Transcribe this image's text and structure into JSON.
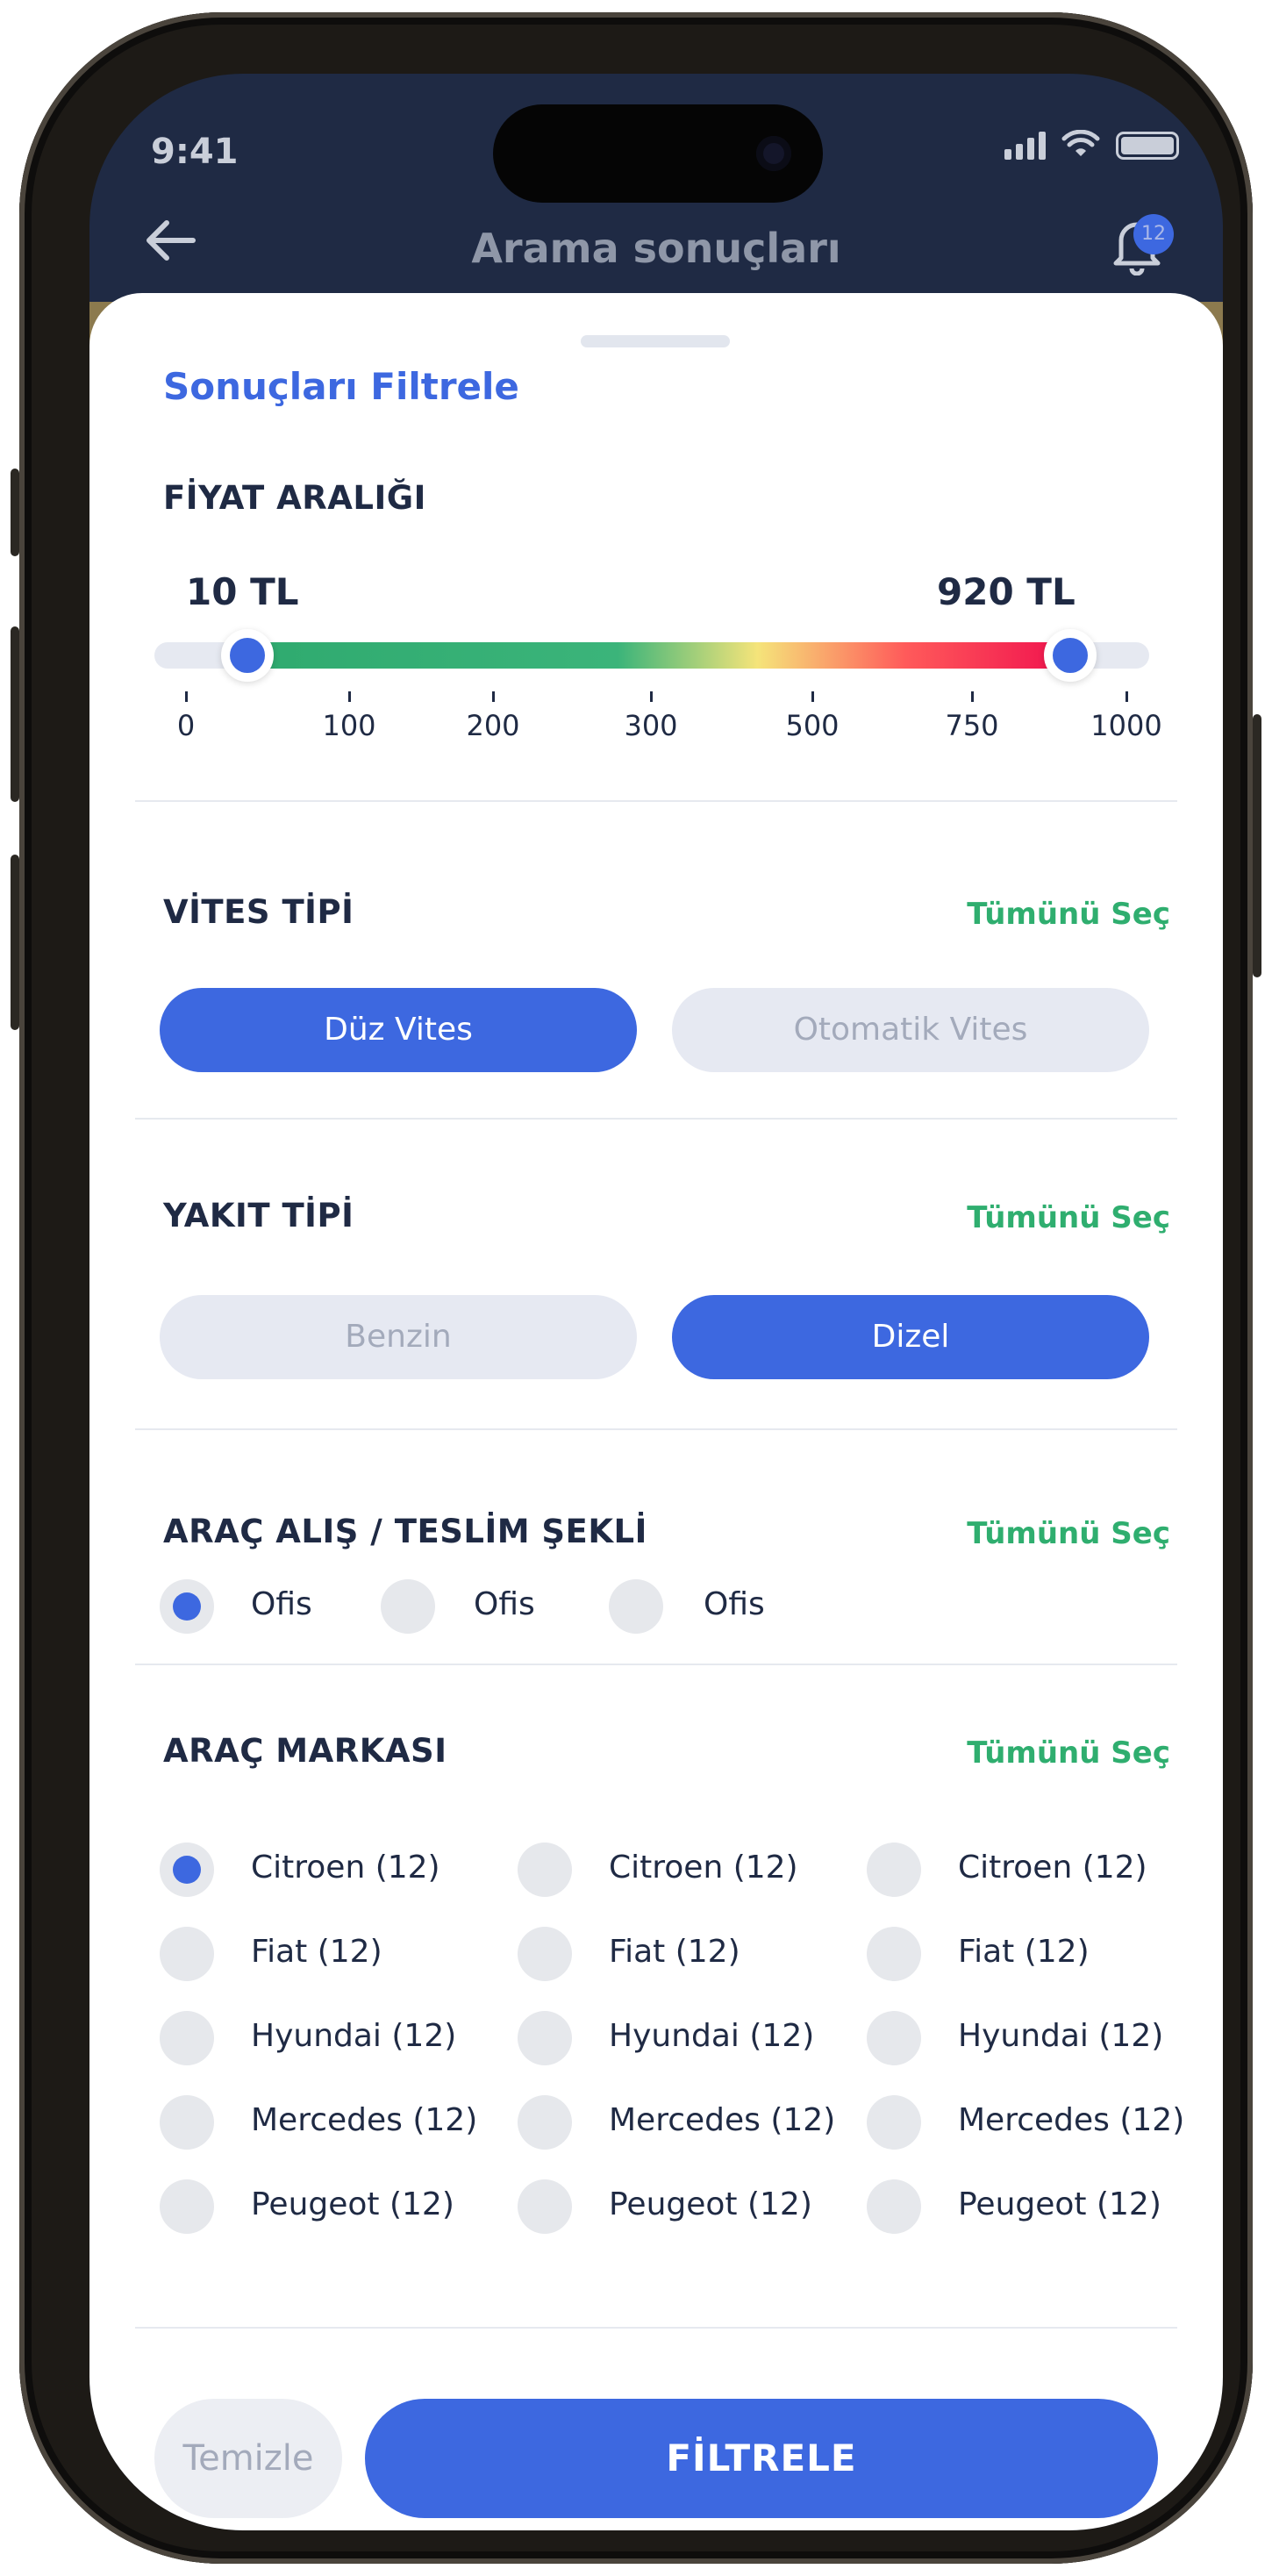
{
  "status_bar": {
    "time": "9:41"
  },
  "header": {
    "title": "Arama sonuçları",
    "notification_count": "12"
  },
  "sheet": {
    "title": "Sonuçları Filtrele",
    "price": {
      "title": "FİYAT ARALIĞI",
      "min_label": "10 TL",
      "max_label": "920 TL",
      "min_value": 10,
      "max_value": 920,
      "ticks": [
        "0",
        "100",
        "200",
        "300",
        "500",
        "750",
        "1000"
      ]
    },
    "gear": {
      "title": "VİTES TİPİ",
      "select_all": "Tümünü Seç",
      "options": [
        {
          "label": "Düz Vites",
          "selected": true
        },
        {
          "label": "Otomatik Vites",
          "selected": false
        }
      ]
    },
    "fuel": {
      "title": "YAKIT TİPİ",
      "select_all": "Tümünü Seç",
      "options": [
        {
          "label": "Benzin",
          "selected": false
        },
        {
          "label": "Dizel",
          "selected": true
        }
      ]
    },
    "pickup": {
      "title": "ARAÇ ALIŞ / TESLİM ŞEKLİ",
      "select_all": "Tümünü Seç",
      "options": [
        {
          "label": "Ofis",
          "selected": true
        },
        {
          "label": "Ofis",
          "selected": false
        },
        {
          "label": "Ofis",
          "selected": false
        }
      ]
    },
    "brand": {
      "title": "ARAÇ MARKASI",
      "select_all": "Tümünü Seç",
      "columns": [
        [
          "Citroen (12)",
          "Fiat (12)",
          "Hyundai (12)",
          "Mercedes (12)",
          "Peugeot (12)"
        ],
        [
          "Citroen (12)",
          "Fiat (12)",
          "Hyundai (12)",
          "Mercedes (12)",
          "Peugeot (12)"
        ],
        [
          "Citroen (12)",
          "Fiat (12)",
          "Hyundai (12)",
          "Mercedes (12)",
          "Peugeot (12)"
        ]
      ],
      "selected": [
        [
          0,
          0
        ]
      ]
    },
    "buttons": {
      "clear": "Temizle",
      "filter": "FİLTRELE"
    }
  },
  "colors": {
    "primary": "#3d68e0",
    "accent": "#2fae6f",
    "header_bg": "#1f2a44",
    "text": "#1f2a44"
  }
}
